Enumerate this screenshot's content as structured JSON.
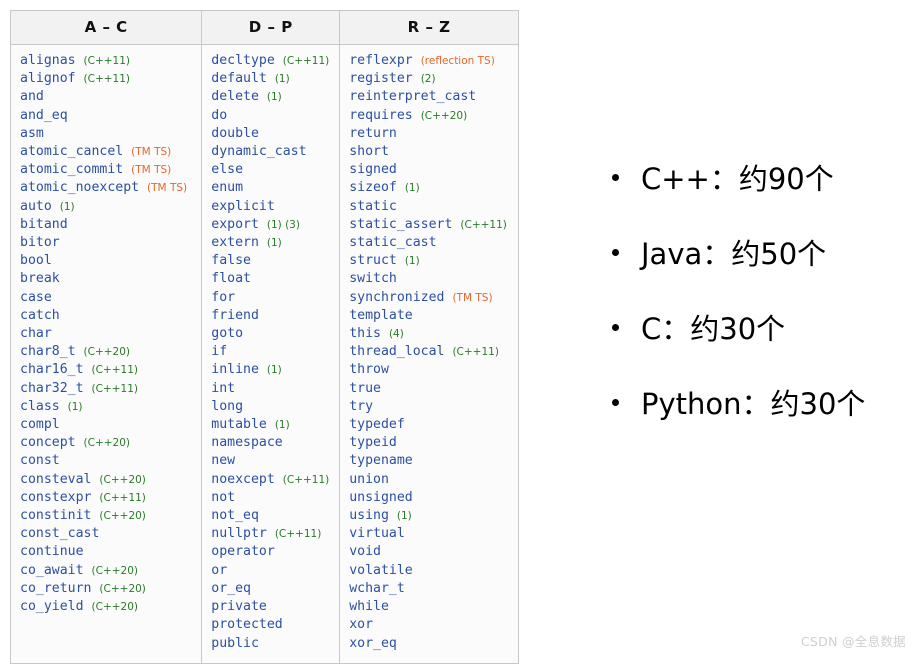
{
  "table": {
    "columns": [
      {
        "header": "A – C",
        "keywords": [
          {
            "name": "alignas",
            "note": "(C++11)",
            "note_color": "green"
          },
          {
            "name": "alignof",
            "note": "(C++11)",
            "note_color": "green"
          },
          {
            "name": "and",
            "note": "",
            "note_color": ""
          },
          {
            "name": "and_eq",
            "note": "",
            "note_color": ""
          },
          {
            "name": "asm",
            "note": "",
            "note_color": ""
          },
          {
            "name": "atomic_cancel",
            "note": "(TM TS)",
            "note_color": "orange"
          },
          {
            "name": "atomic_commit",
            "note": "(TM TS)",
            "note_color": "orange"
          },
          {
            "name": "atomic_noexcept",
            "note": "(TM TS)",
            "note_color": "orange"
          },
          {
            "name": "auto",
            "note": "(1)",
            "note_color": "green"
          },
          {
            "name": "bitand",
            "note": "",
            "note_color": ""
          },
          {
            "name": "bitor",
            "note": "",
            "note_color": ""
          },
          {
            "name": "bool",
            "note": "",
            "note_color": ""
          },
          {
            "name": "break",
            "note": "",
            "note_color": ""
          },
          {
            "name": "case",
            "note": "",
            "note_color": ""
          },
          {
            "name": "catch",
            "note": "",
            "note_color": ""
          },
          {
            "name": "char",
            "note": "",
            "note_color": ""
          },
          {
            "name": "char8_t",
            "note": "(C++20)",
            "note_color": "green"
          },
          {
            "name": "char16_t",
            "note": "(C++11)",
            "note_color": "green"
          },
          {
            "name": "char32_t",
            "note": "(C++11)",
            "note_color": "green"
          },
          {
            "name": "class",
            "note": "(1)",
            "note_color": "green"
          },
          {
            "name": "compl",
            "note": "",
            "note_color": ""
          },
          {
            "name": "concept",
            "note": "(C++20)",
            "note_color": "green"
          },
          {
            "name": "const",
            "note": "",
            "note_color": ""
          },
          {
            "name": "consteval",
            "note": "(C++20)",
            "note_color": "green"
          },
          {
            "name": "constexpr",
            "note": "(C++11)",
            "note_color": "green"
          },
          {
            "name": "constinit",
            "note": "(C++20)",
            "note_color": "green"
          },
          {
            "name": "const_cast",
            "note": "",
            "note_color": ""
          },
          {
            "name": "continue",
            "note": "",
            "note_color": ""
          },
          {
            "name": "co_await",
            "note": "(C++20)",
            "note_color": "green"
          },
          {
            "name": "co_return",
            "note": "(C++20)",
            "note_color": "green"
          },
          {
            "name": "co_yield",
            "note": "(C++20)",
            "note_color": "green"
          }
        ]
      },
      {
        "header": "D – P",
        "keywords": [
          {
            "name": "decltype",
            "note": "(C++11)",
            "note_color": "green"
          },
          {
            "name": "default",
            "note": "(1)",
            "note_color": "green"
          },
          {
            "name": "delete",
            "note": "(1)",
            "note_color": "green"
          },
          {
            "name": "do",
            "note": "",
            "note_color": ""
          },
          {
            "name": "double",
            "note": "",
            "note_color": ""
          },
          {
            "name": "dynamic_cast",
            "note": "",
            "note_color": ""
          },
          {
            "name": "else",
            "note": "",
            "note_color": ""
          },
          {
            "name": "enum",
            "note": "",
            "note_color": ""
          },
          {
            "name": "explicit",
            "note": "",
            "note_color": ""
          },
          {
            "name": "export",
            "note": "(1) (3)",
            "note_color": "green"
          },
          {
            "name": "extern",
            "note": "(1)",
            "note_color": "green"
          },
          {
            "name": "false",
            "note": "",
            "note_color": ""
          },
          {
            "name": "float",
            "note": "",
            "note_color": ""
          },
          {
            "name": "for",
            "note": "",
            "note_color": ""
          },
          {
            "name": "friend",
            "note": "",
            "note_color": ""
          },
          {
            "name": "goto",
            "note": "",
            "note_color": ""
          },
          {
            "name": "if",
            "note": "",
            "note_color": ""
          },
          {
            "name": "inline",
            "note": "(1)",
            "note_color": "green"
          },
          {
            "name": "int",
            "note": "",
            "note_color": ""
          },
          {
            "name": "long",
            "note": "",
            "note_color": ""
          },
          {
            "name": "mutable",
            "note": "(1)",
            "note_color": "green"
          },
          {
            "name": "namespace",
            "note": "",
            "note_color": ""
          },
          {
            "name": "new",
            "note": "",
            "note_color": ""
          },
          {
            "name": "noexcept",
            "note": "(C++11)",
            "note_color": "green"
          },
          {
            "name": "not",
            "note": "",
            "note_color": ""
          },
          {
            "name": "not_eq",
            "note": "",
            "note_color": ""
          },
          {
            "name": "nullptr",
            "note": "(C++11)",
            "note_color": "green"
          },
          {
            "name": "operator",
            "note": "",
            "note_color": ""
          },
          {
            "name": "or",
            "note": "",
            "note_color": ""
          },
          {
            "name": "or_eq",
            "note": "",
            "note_color": ""
          },
          {
            "name": "private",
            "note": "",
            "note_color": ""
          },
          {
            "name": "protected",
            "note": "",
            "note_color": ""
          },
          {
            "name": "public",
            "note": "",
            "note_color": ""
          }
        ]
      },
      {
        "header": "R – Z",
        "keywords": [
          {
            "name": "reflexpr",
            "note": "(reflection TS)",
            "note_color": "orange"
          },
          {
            "name": "register",
            "note": "(2)",
            "note_color": "green"
          },
          {
            "name": "reinterpret_cast",
            "note": "",
            "note_color": ""
          },
          {
            "name": "requires",
            "note": "(C++20)",
            "note_color": "green"
          },
          {
            "name": "return",
            "note": "",
            "note_color": ""
          },
          {
            "name": "short",
            "note": "",
            "note_color": ""
          },
          {
            "name": "signed",
            "note": "",
            "note_color": ""
          },
          {
            "name": "sizeof",
            "note": "(1)",
            "note_color": "green"
          },
          {
            "name": "static",
            "note": "",
            "note_color": ""
          },
          {
            "name": "static_assert",
            "note": "(C++11)",
            "note_color": "green"
          },
          {
            "name": "static_cast",
            "note": "",
            "note_color": ""
          },
          {
            "name": "struct",
            "note": "(1)",
            "note_color": "green"
          },
          {
            "name": "switch",
            "note": "",
            "note_color": ""
          },
          {
            "name": "synchronized",
            "note": "(TM TS)",
            "note_color": "orange"
          },
          {
            "name": "template",
            "note": "",
            "note_color": ""
          },
          {
            "name": "this",
            "note": "(4)",
            "note_color": "green"
          },
          {
            "name": "thread_local",
            "note": "(C++11)",
            "note_color": "green"
          },
          {
            "name": "throw",
            "note": "",
            "note_color": ""
          },
          {
            "name": "true",
            "note": "",
            "note_color": ""
          },
          {
            "name": "try",
            "note": "",
            "note_color": ""
          },
          {
            "name": "typedef",
            "note": "",
            "note_color": ""
          },
          {
            "name": "typeid",
            "note": "",
            "note_color": ""
          },
          {
            "name": "typename",
            "note": "",
            "note_color": ""
          },
          {
            "name": "union",
            "note": "",
            "note_color": ""
          },
          {
            "name": "unsigned",
            "note": "",
            "note_color": ""
          },
          {
            "name": "using",
            "note": "(1)",
            "note_color": "green"
          },
          {
            "name": "virtual",
            "note": "",
            "note_color": ""
          },
          {
            "name": "void",
            "note": "",
            "note_color": ""
          },
          {
            "name": "volatile",
            "note": "",
            "note_color": ""
          },
          {
            "name": "wchar_t",
            "note": "",
            "note_color": ""
          },
          {
            "name": "while",
            "note": "",
            "note_color": ""
          },
          {
            "name": "xor",
            "note": "",
            "note_color": ""
          },
          {
            "name": "xor_eq",
            "note": "",
            "note_color": ""
          }
        ]
      }
    ]
  },
  "summary": {
    "items": [
      {
        "text": "C++：约90个"
      },
      {
        "text": "Java：约50个"
      },
      {
        "text": "C：约30个"
      },
      {
        "text": "Python：约30个"
      }
    ]
  },
  "watermark": {
    "text": "CSDN @全息数据"
  },
  "colors": {
    "keyword": "#2d4fa2",
    "note_green": "#2a7a28",
    "note_orange": "#e8662a",
    "header_bg": "#f2f2f2",
    "cell_bg": "#fbfbfb",
    "border": "#c8c8c8",
    "watermark": "#cfcfcf"
  }
}
